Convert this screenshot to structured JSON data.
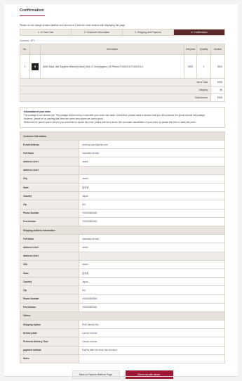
{
  "page": {
    "title": "Confirmation",
    "notice": "Please do not change product addition and amount of it with the other window with displaying this page"
  },
  "steps": [
    "1. In Your Cart",
    "2. Customer Information",
    "3. Shipping and Payment",
    "4. Confirmation"
  ],
  "currency": "Currency : JPY",
  "items_table": {
    "headers": {
      "no": "No.",
      "name": "Item Name",
      "unit": "Unit price",
      "qty": "Quantity",
      "amount": "Amount"
    },
    "row": {
      "no": "1",
      "name": "MAN Glass Leaf   Sapphire Women(Cotton)   Size=17.4mm(Approx.)   30 Pieces   FC10247A FC10247A-1",
      "unit": "¥200",
      "qty": "1",
      "amount": "¥200"
    },
    "items_total_label": "Items Total",
    "items_total": "¥259",
    "shipping_label": "Shipping",
    "shipping": "¥0",
    "total_label": "Total Amount",
    "total": "¥259"
  },
  "info_box": {
    "heading": "Information of your order",
    "lines": [
      "The postage is not decided yet. The postage will be told by e-mail after your order has made. At that time, please make a decision that you will purchase the goods include the postage.",
      "However, please let us warning that there are some area where we cannot send.",
      "Whenever the parcel cannot send or you would like to cancel the order, please just let us know. We can make cancellation of your order, so please feel free to make this order."
    ]
  },
  "customer": {
    "section": "Customer Information",
    "rows": [
      {
        "label": "E-mail Address",
        "value": "mummy.popo@gmail.com"
      },
      {
        "label": "Full Name",
        "value": "masataka shirato"
      },
      {
        "label": "Address Line1",
        "value": "osaka"
      },
      {
        "label": "Address Line2",
        "value": ""
      },
      {
        "label": "City",
        "value": "osaka"
      },
      {
        "label": "State",
        "value": "岩手県"
      },
      {
        "label": "Country",
        "value": "Japan"
      },
      {
        "label": "Zip",
        "value": "610"
      },
      {
        "label": "Phone Number",
        "value": "+81906584560"
      },
      {
        "label": "Fax Number",
        "value": "+81906584560"
      }
    ]
  },
  "shipping": {
    "section": "Shipping Address Information",
    "rows": [
      {
        "label": "Full Name",
        "value": "masataka shirato"
      },
      {
        "label": "Address Line1",
        "value": "osaka"
      },
      {
        "label": "Address Line2",
        "value": ""
      },
      {
        "label": "City",
        "value": "osaka"
      },
      {
        "label": "State",
        "value": "岩手県"
      },
      {
        "label": "Country",
        "value": "Japan"
      },
      {
        "label": "Zip",
        "value": "610"
      },
      {
        "label": "Phone Number",
        "value": "+81906584560"
      },
      {
        "label": "Fax Number",
        "value": "+81906584560"
      }
    ]
  },
  "others": {
    "section": "Others",
    "rows": [
      {
        "label": "Shipping Option",
        "value": "EMS Airmail SAL"
      },
      {
        "label": "Delivery date",
        "value": "Cannot choose"
      },
      {
        "label": "Preferred Delivery Time",
        "value": "Cannot choose"
      },
      {
        "label": "payment method",
        "value": "PayPal after the stock has checked"
      },
      {
        "label": "Notes",
        "value": ""
      }
    ]
  },
  "buttons": {
    "back": "Back to Payment Method Page",
    "check": "Check out with above."
  },
  "colors": {
    "accent": "#a01733",
    "active_step": "#5a2a2a",
    "cell_bg": "#efece7"
  }
}
